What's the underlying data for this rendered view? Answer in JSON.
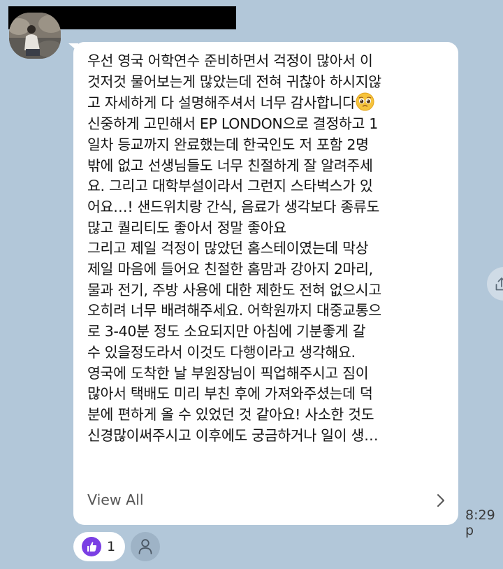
{
  "message": {
    "lines": [
      "우선 영국 어학연수 준비하면서 걱정이 많아서 이",
      "것저것 물어보는게 많았는데 전혀 귀찮아 하시지않",
      "고 자세하게 다 설명해주셔서 너무 감사합니다",
      "신중하게 고민해서 EP LONDON으로 결정하고 1",
      "일차 등교까지 완료했는데 한국인도 저 포함 2명",
      "밖에 없고 선생님들도 너무 친절하게 잘 알려주세",
      "요. 그리고 대학부설이라서 그런지 스타벅스가 있",
      "어요…! 샌드위치랑 간식, 음료가 생각보다 종류도",
      "많고 퀄리티도 좋아서 정말 좋아요",
      "그리고 제일 걱정이 많았던 홈스테이였는데 막상",
      "제일 마음에 들어요 친절한 홈맘과 강아지 2마리,",
      "물과 전기, 주방 사용에 대한 제한도 전혀 없으시고",
      "오히려 너무 배려해주세요. 어학원까지 대중교통으",
      "로 3-40분 정도 소요되지만 아침에 기분좋게 갈",
      "수 있을정도라서 이것도 다행이라고 생각해요.",
      "영국에 도착한 날 부원장님이 픽업해주시고 짐이",
      "많아서 택배도 미리 부친 후에 가져와주셨는데 덕",
      "분에 편하게 올 수 있었던 것 같아요! 사소한 것도",
      "신경많이써주시고 이후에도 궁금하거나 일이 생…"
    ],
    "emoji_after_line_2": "pleading-face-emoji",
    "view_all_label": "View All",
    "timestamp": "8:29 p"
  },
  "reactions": {
    "like_count": "1",
    "like_icon": "thumbs-up-icon",
    "add_icon": "person-icon"
  },
  "colors": {
    "chat_background": "#b2c7d9",
    "bubble": "#ffffff",
    "like_badge": "#7b3fe4"
  }
}
